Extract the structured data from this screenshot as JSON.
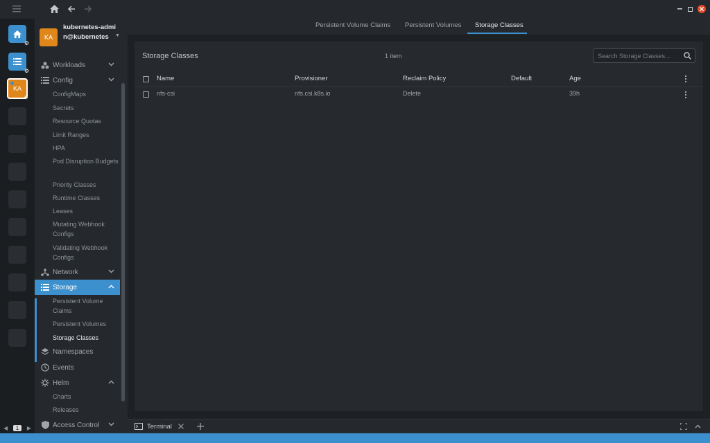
{
  "colors": {
    "accent": "#3d90ce",
    "cluster": "#e0871c",
    "close": "#e04a2b"
  },
  "hotbar": {
    "cluster_short": "KA",
    "page": "1"
  },
  "cluster": {
    "avatar": "KA",
    "name": "kubernetes-admin@kubernetes"
  },
  "nav": {
    "workloads": "Workloads",
    "config": "Config",
    "config_items": [
      "ConfigMaps",
      "Secrets",
      "Resource Quotas",
      "Limit Ranges",
      "HPA",
      "Pod Disruption Budgets",
      "Priority Classes",
      "Runtime Classes",
      "Leases",
      "Mutating Webhook Configs",
      "Validating Webhook Configs"
    ],
    "network": "Network",
    "storage": "Storage",
    "storage_items": [
      "Persistent Volume Claims",
      "Persistent Volumes",
      "Storage Classes"
    ],
    "namespaces": "Namespaces",
    "events": "Events",
    "helm": "Helm",
    "helm_items": [
      "Charts",
      "Releases"
    ],
    "access_control": "Access Control"
  },
  "tabs": [
    "Persistent Volume Claims",
    "Persistent Volumes",
    "Storage Classes"
  ],
  "panel": {
    "title": "Storage Classes",
    "count": "1 item",
    "search_placeholder": "Search Storage Classes...",
    "columns": [
      "Name",
      "Provisioner",
      "Reclaim Policy",
      "Default",
      "Age"
    ],
    "rows": [
      {
        "name": "nfs-csi",
        "provisioner": "nfs.csi.k8s.io",
        "reclaim": "Delete",
        "default": "",
        "age": "39h"
      }
    ]
  },
  "dock": {
    "terminal": "Terminal"
  }
}
